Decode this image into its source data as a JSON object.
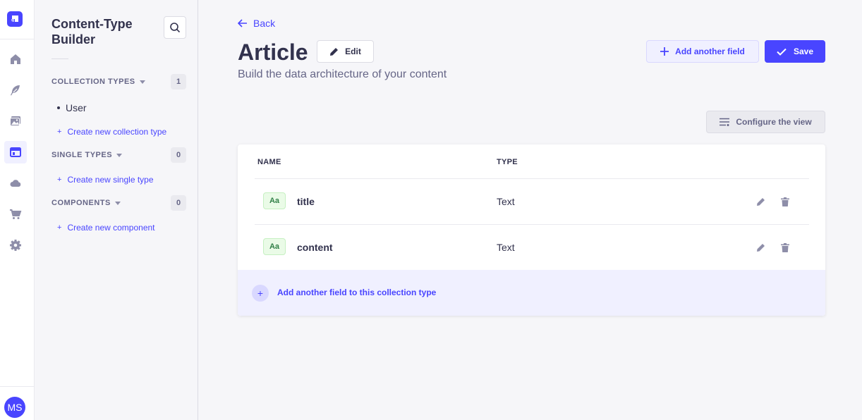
{
  "user": {
    "initials": "MS"
  },
  "rail": {
    "items": [
      {
        "icon": "home-icon"
      },
      {
        "icon": "feather-icon"
      },
      {
        "icon": "image-icon"
      },
      {
        "icon": "layout-icon",
        "active": true
      },
      {
        "icon": "cloud-icon"
      },
      {
        "icon": "cart-icon"
      },
      {
        "icon": "gear-icon"
      }
    ]
  },
  "subnav": {
    "title": "Content-Type Builder",
    "sections": [
      {
        "label": "COLLECTION TYPES",
        "count": "1",
        "items": [
          "User"
        ],
        "create": "Create new collection type"
      },
      {
        "label": "SINGLE TYPES",
        "count": "0",
        "items": [],
        "create": "Create new single type"
      },
      {
        "label": "COMPONENTS",
        "count": "0",
        "items": [],
        "create": "Create new component"
      }
    ]
  },
  "header": {
    "back": "Back",
    "title": "Article",
    "edit": "Edit",
    "subtitle": "Build the data architecture of your content",
    "add_field": "Add another field",
    "save": "Save"
  },
  "configure_view": "Configure the view",
  "table": {
    "columns": [
      "NAME",
      "TYPE"
    ],
    "rows": [
      {
        "icon": "Aa",
        "name": "title",
        "type": "Text"
      },
      {
        "icon": "Aa",
        "name": "content",
        "type": "Text"
      }
    ],
    "add_row": "Add another field to this collection type"
  },
  "colors": {
    "accent": "#4945ff",
    "accent_light": "#f0f0ff",
    "text": "#32324d",
    "muted": "#666687"
  }
}
